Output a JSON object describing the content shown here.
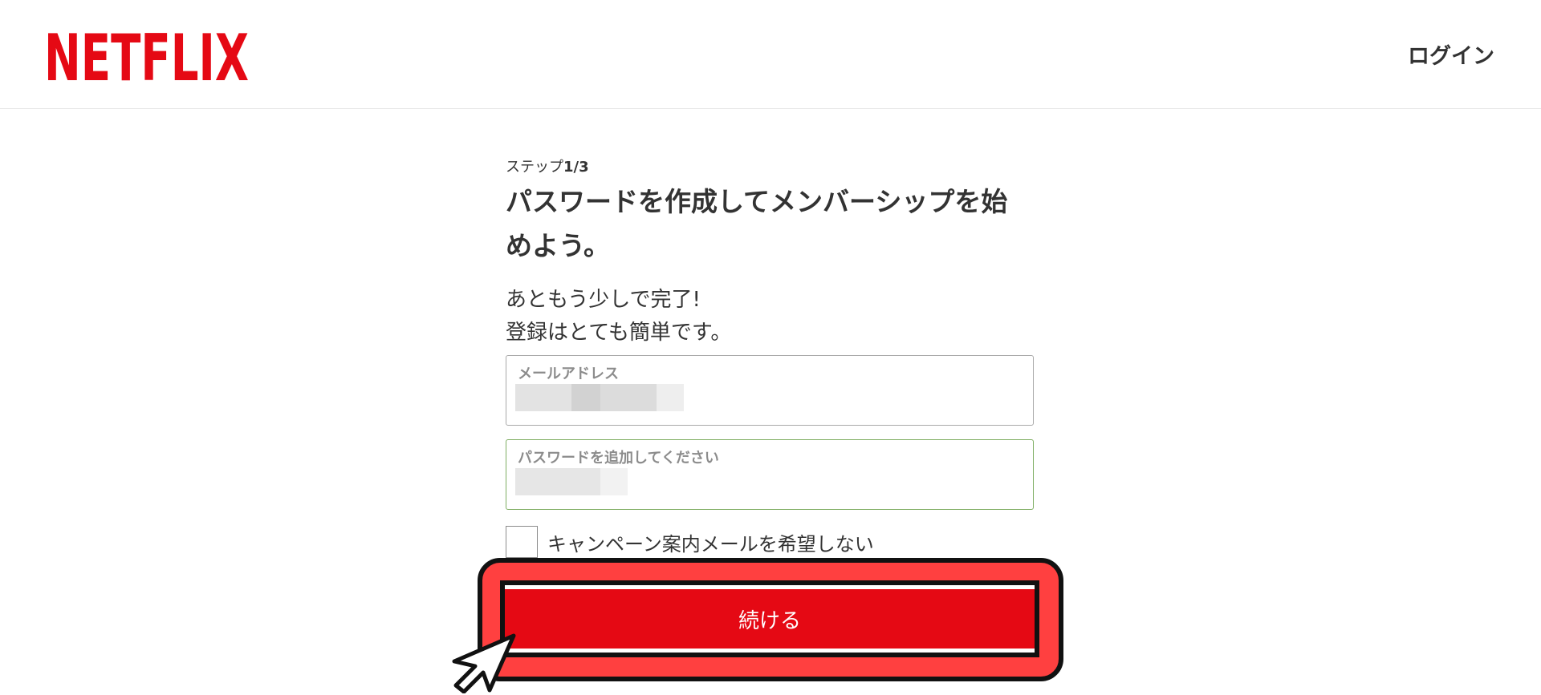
{
  "header": {
    "logo_text": "NETFLIX",
    "login_label": "ログイン"
  },
  "signup": {
    "step_prefix": "ステップ",
    "step_value": "1/3",
    "title": "パスワードを作成してメンバーシップを始めよう。",
    "subtitle_line1": "あともう少しで完了!",
    "subtitle_line2": "登録はとても簡単です。",
    "email_label": "メールアドレス",
    "password_label": "パスワードを追加してください",
    "checkbox_label": "キャンペーン案内メールを希望しない",
    "continue_label": "続ける"
  },
  "colors": {
    "brand_red": "#e50914",
    "highlight_red": "#ff4040",
    "text": "#333333"
  }
}
